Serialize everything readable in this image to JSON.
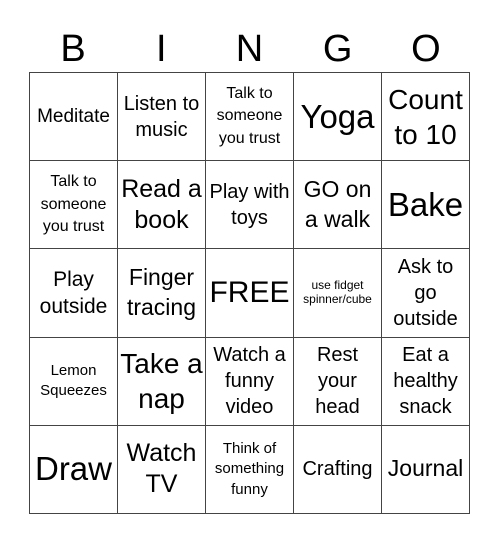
{
  "header": [
    "B",
    "I",
    "N",
    "G",
    "O"
  ],
  "cells": [
    {
      "text": "Meditate",
      "size": "s19"
    },
    {
      "text": "Listen to music",
      "size": "s20"
    },
    {
      "text": "Talk to someone you trust",
      "size": "s16"
    },
    {
      "text": "Yoga",
      "size": "s33"
    },
    {
      "text": "Count to 10",
      "size": "s28"
    },
    {
      "text": "Talk to someone you trust",
      "size": "s16"
    },
    {
      "text": "Read a book",
      "size": "s25"
    },
    {
      "text": "Play with toys",
      "size": "s20"
    },
    {
      "text": "GO on a walk",
      "size": "s23"
    },
    {
      "text": "Bake",
      "size": "s33"
    },
    {
      "text": "Play outside",
      "size": "s21"
    },
    {
      "text": "Finger tracing",
      "size": "s23"
    },
    {
      "text": "FREE",
      "size": "s30"
    },
    {
      "text": "use fidget spinner/cube",
      "size": "s13"
    },
    {
      "text": "Ask to go outside",
      "size": "s20"
    },
    {
      "text": "Lemon Squeezes",
      "size": "s15"
    },
    {
      "text": "Take a nap",
      "size": "s28"
    },
    {
      "text": "Watch a funny video",
      "size": "s20"
    },
    {
      "text": "Rest your head",
      "size": "s20"
    },
    {
      "text": "Eat a healthy snack",
      "size": "s20"
    },
    {
      "text": "Draw",
      "size": "s33"
    },
    {
      "text": "Watch TV",
      "size": "s25"
    },
    {
      "text": "Think of something funny",
      "size": "s15"
    },
    {
      "text": "Crafting",
      "size": "s20"
    },
    {
      "text": "Journal",
      "size": "s23"
    }
  ]
}
